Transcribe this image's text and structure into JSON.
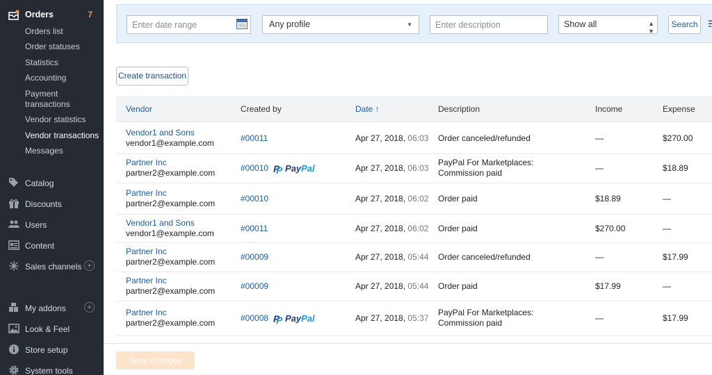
{
  "sidebar": {
    "orders": {
      "label": "Orders",
      "badge": "7"
    },
    "sub_items": [
      {
        "label": "Orders list"
      },
      {
        "label": "Order statuses"
      },
      {
        "label": "Statistics"
      },
      {
        "label": "Accounting"
      },
      {
        "label": "Payment transactions"
      },
      {
        "label": "Vendor statistics"
      },
      {
        "label": "Vendor transactions"
      },
      {
        "label": "Messages"
      }
    ],
    "main_items": [
      {
        "label": "Catalog",
        "icon": "tag-icon"
      },
      {
        "label": "Discounts",
        "icon": "gift-icon"
      },
      {
        "label": "Users",
        "icon": "users-icon"
      },
      {
        "label": "Content",
        "icon": "content-icon"
      },
      {
        "label": "Sales channels",
        "icon": "network-icon"
      },
      {
        "label": "My addons",
        "icon": "puzzle-icon"
      },
      {
        "label": "Look & Feel",
        "icon": "image-icon"
      },
      {
        "label": "Store setup",
        "icon": "info-icon"
      },
      {
        "label": "System tools",
        "icon": "gear-icon"
      }
    ],
    "active_item": "Vendor transactions"
  },
  "filters": {
    "date_placeholder": "Enter date range",
    "profile_value": "Any profile",
    "description_placeholder": "Enter description",
    "show_value": "Show all",
    "search_label": "Search"
  },
  "create_label": "Create transaction",
  "table": {
    "headers": {
      "vendor": "Vendor",
      "created_by": "Created by",
      "date": "Date ↑",
      "description": "Description",
      "income": "Income",
      "expense": "Expense"
    },
    "rows": [
      {
        "vendor": "Vendor1 and Sons",
        "email": "vendor1@example.com",
        "order": "#00011",
        "paypal": false,
        "date": "Apr 27, 2018,",
        "time": "06:03",
        "description": "Order canceled/refunded",
        "income": "—",
        "expense": "$270.00"
      },
      {
        "vendor": "Partner Inc",
        "email": "partner2@example.com",
        "order": "#00010",
        "paypal": true,
        "date": "Apr 27, 2018,",
        "time": "06:03",
        "description": "PayPal For Marketplaces: Commission paid",
        "income": "—",
        "expense": "$18.89"
      },
      {
        "vendor": "Partner Inc",
        "email": "partner2@example.com",
        "order": "#00010",
        "paypal": false,
        "date": "Apr 27, 2018,",
        "time": "06:02",
        "description": "Order paid",
        "income": "$18.89",
        "expense": "—"
      },
      {
        "vendor": "Vendor1 and Sons",
        "email": "vendor1@example.com",
        "order": "#00011",
        "paypal": false,
        "date": "Apr 27, 2018,",
        "time": "06:02",
        "description": "Order paid",
        "income": "$270.00",
        "expense": "—"
      },
      {
        "vendor": "Partner Inc",
        "email": "partner2@example.com",
        "order": "#00009",
        "paypal": false,
        "date": "Apr 27, 2018,",
        "time": "05:44",
        "description": "Order canceled/refunded",
        "income": "—",
        "expense": "$17.99"
      },
      {
        "vendor": "Partner Inc",
        "email": "partner2@example.com",
        "order": "#00009",
        "paypal": false,
        "date": "Apr 27, 2018,",
        "time": "05:44",
        "description": "Order paid",
        "income": "$17.99",
        "expense": "—"
      },
      {
        "vendor": "Partner Inc",
        "email": "partner2@example.com",
        "order": "#00008",
        "paypal": true,
        "date": "Apr 27, 2018,",
        "time": "05:37",
        "description": "PayPal For Marketplaces: Commission paid",
        "income": "—",
        "expense": "$17.99"
      }
    ]
  },
  "paypal_logo": {
    "pay": "Pay",
    "pal": "Pal"
  },
  "save_label": "Save changes",
  "colors": {
    "sidebar_bg": "#252a33",
    "link": "#1c5b9e",
    "badge": "#f29a39",
    "filter_bg": "#e6f1fb",
    "save_disabled": "#fbe3cc"
  }
}
